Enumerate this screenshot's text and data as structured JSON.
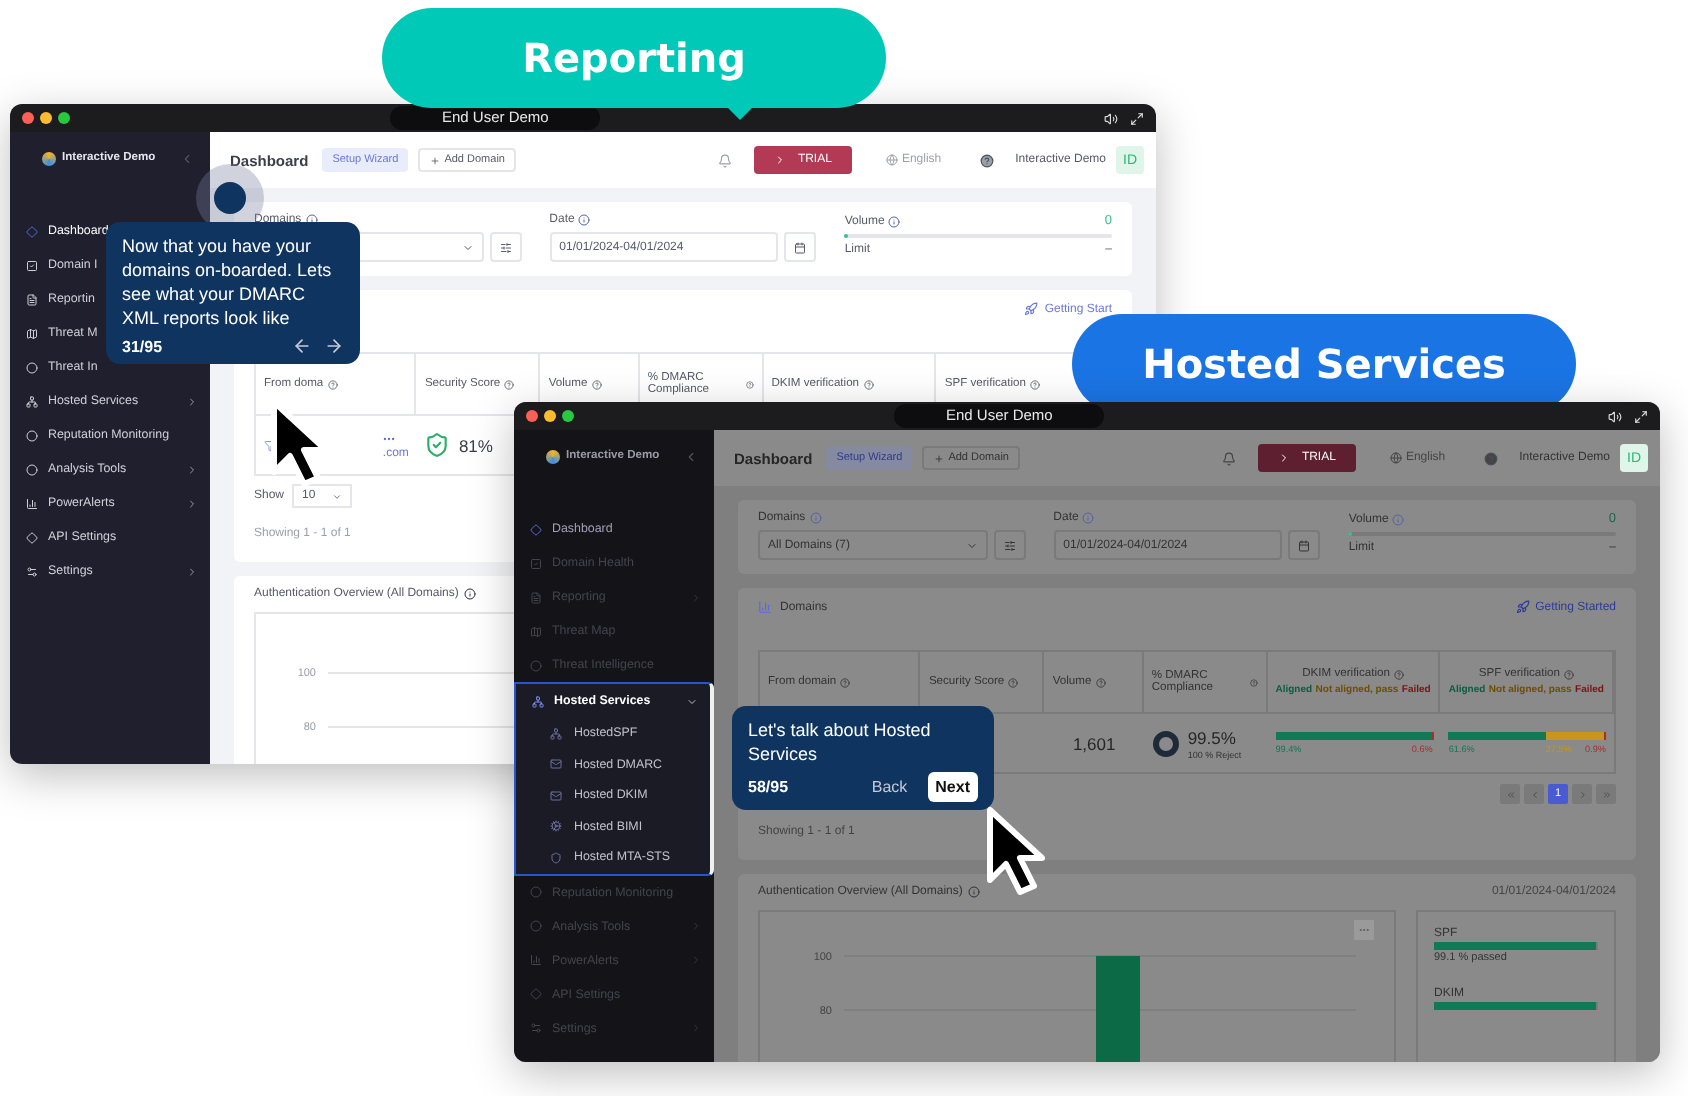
{
  "callouts": [
    {
      "label": "Reporting",
      "color": "#00c9b7"
    },
    {
      "label": "Hosted Services",
      "color": "#1b74e4"
    }
  ],
  "windows": [
    {
      "title": "End User Demo",
      "dimmed": false,
      "brand": "Interactive Demo",
      "sidebar": [
        {
          "label": "Dashboard",
          "selected": true,
          "highlighted": false
        },
        {
          "label": "Domain I",
          "selected": false,
          "highlighted": false
        },
        {
          "label": "Reportin",
          "selected": false,
          "highlighted": false
        },
        {
          "label": "Threat M",
          "selected": false,
          "highlighted": false
        },
        {
          "label": "Threat In",
          "selected": false,
          "highlighted": false
        },
        {
          "label": "Hosted Services",
          "selected": false,
          "highlighted": false,
          "submenu": {
            "expanded": false
          }
        },
        {
          "label": "Reputation Monitoring",
          "selected": false,
          "highlighted": false
        },
        {
          "label": "Analysis Tools",
          "selected": false,
          "highlighted": false,
          "submenu": {
            "expanded": false
          }
        },
        {
          "label": "PowerAlerts",
          "selected": false,
          "highlighted": false,
          "submenu": {
            "expanded": false
          }
        },
        {
          "label": "API Settings",
          "selected": false,
          "highlighted": false
        },
        {
          "label": "Settings",
          "selected": false,
          "highlighted": false,
          "submenu": {
            "expanded": false
          }
        }
      ],
      "topbar": {
        "page": "Dashboard",
        "wizard": "Setup Wizard",
        "add": "Add Domain",
        "trial": "TRIAL",
        "language": "English",
        "user": "Interactive Demo",
        "avatar": "ID"
      },
      "filters": {
        "domains_label": "Domains",
        "date_label": "Date",
        "date": "01/01/2024-04/01/2024",
        "volume_label": "Volume",
        "volume": "0",
        "limit_label": "Limit",
        "limit": "–",
        "level": 0.01
      },
      "domains": {
        "getting_started": "Getting Start",
        "columns": [
          {
            "label": "From doma"
          },
          {
            "label": "Security Score"
          },
          {
            "label": "Volume"
          },
          {
            "label": "% DMARC Compliance"
          },
          {
            "label": "DKIM verification"
          },
          {
            "label": "SPF verification"
          }
        ],
        "row": {
          "domain": ".com",
          "score": "81%"
        },
        "show_label": "Show",
        "show_value": "10",
        "showing": "Showing 1 - 1 of 1"
      },
      "overview": {
        "title": "Authentication Overview (All Domains)",
        "axis_labels": [
          "100",
          "80"
        ]
      },
      "tour": {
        "kind": "arrows",
        "text": "Now that you have your domains on-boarded. Lets see what your DMARC XML reports look like",
        "step": "31/95"
      }
    },
    {
      "title": "End User Demo",
      "dimmed": true,
      "brand": "Interactive Demo",
      "sidebar": [
        {
          "label": "Dashboard",
          "selected": true,
          "highlighted": false
        },
        {
          "label": "Domain Health",
          "selected": false,
          "highlighted": false
        },
        {
          "label": "Reporting",
          "selected": false,
          "highlighted": false,
          "submenu": {
            "expanded": false
          }
        },
        {
          "label": "Threat Map",
          "selected": false,
          "highlighted": false
        },
        {
          "label": "Threat Intelligence",
          "selected": false,
          "highlighted": false
        },
        {
          "label": "Hosted Services",
          "selected": false,
          "highlighted": true,
          "submenu": {
            "expanded": true,
            "children": [
              {
                "label": "HostedSPF"
              },
              {
                "label": "Hosted DMARC"
              },
              {
                "label": "Hosted DKIM"
              },
              {
                "label": "Hosted BIMI"
              },
              {
                "label": "Hosted MTA-STS"
              }
            ]
          }
        },
        {
          "label": "Reputation Monitoring",
          "selected": false,
          "highlighted": false
        },
        {
          "label": "Analysis Tools",
          "selected": false,
          "highlighted": false,
          "submenu": {
            "expanded": false
          }
        },
        {
          "label": "PowerAlerts",
          "selected": false,
          "highlighted": false,
          "submenu": {
            "expanded": false
          }
        },
        {
          "label": "API Settings",
          "selected": false,
          "highlighted": false
        },
        {
          "label": "Settings",
          "selected": false,
          "highlighted": false,
          "submenu": {
            "expanded": false
          }
        }
      ],
      "topbar": {
        "page": "Dashboard",
        "wizard": "Setup Wizard",
        "add": "Add Domain",
        "trial": "TRIAL",
        "language": "English",
        "user": "Interactive Demo",
        "avatar": "ID"
      },
      "filters": {
        "domains_label": "Domains",
        "domains_value": "All Domains (7)",
        "date_label": "Date",
        "date": "01/01/2024-04/01/2024",
        "volume_label": "Volume",
        "volume": "0",
        "limit_label": "Limit",
        "limit": "–",
        "level": 0.01
      },
      "domains": {
        "title": "Domains",
        "getting_started": "Getting Started",
        "columns": [
          {
            "label": "From domain"
          },
          {
            "label": "Security Score"
          },
          {
            "label": "Volume"
          },
          {
            "label": "% DMARC Compliance"
          },
          {
            "label": "DKIM verification",
            "legend": [
              {
                "label": "Aligned",
                "color": "#0b5e3d"
              },
              {
                "label": "Not aligned, pass",
                "color": "#6e4e00"
              },
              {
                "label": "Failed",
                "color": "#7a1414"
              }
            ]
          },
          {
            "label": "SPF verification",
            "legend": [
              {
                "label": "Aligned",
                "color": "#0b5e3d"
              },
              {
                "label": "Not aligned, pass",
                "color": "#6e4e00"
              },
              {
                "label": "Failed",
                "color": "#7a1414"
              }
            ]
          }
        ],
        "row": {
          "volume": "1,601",
          "dmarc": "99.5%",
          "dmarc_note": "100 % Reject",
          "dkim": [
            {
              "level": 0.994,
              "color": "#0f7a55",
              "label": "99.4%"
            },
            {
              "level": 0.006,
              "color": "#a8302c",
              "label": "0.6%"
            }
          ],
          "spf": [
            {
              "level": 0.616,
              "color": "#0f7a55",
              "label": "61.6%"
            },
            {
              "level": 0.375,
              "color": "#c9951c",
              "label": "37.5%"
            },
            {
              "level": 0.009,
              "color": "#a8302c",
              "label": "0.9%"
            }
          ]
        },
        "pages": [
          {
            "label": "1",
            "selected": true
          }
        ],
        "showing": "Showing 1 - 1 of 1"
      },
      "overview": {
        "title": "Authentication Overview (All Domains)",
        "date": "01/01/2024-04/01/2024",
        "chart_data": {
          "type": "bar",
          "categories": [
            null
          ],
          "values": [
            100
          ],
          "yticks": [
            80,
            100
          ],
          "ylim": [
            60,
            100
          ]
        },
        "side": [
          {
            "label": "SPF",
            "level": 0.991,
            "note": "99.1 % passed"
          },
          {
            "label": "DKIM",
            "level": 0.99
          }
        ]
      },
      "tour": {
        "kind": "buttons",
        "text": "Let's talk about Hosted Services",
        "step": "58/95",
        "back": "Back",
        "next": "Next"
      }
    }
  ]
}
